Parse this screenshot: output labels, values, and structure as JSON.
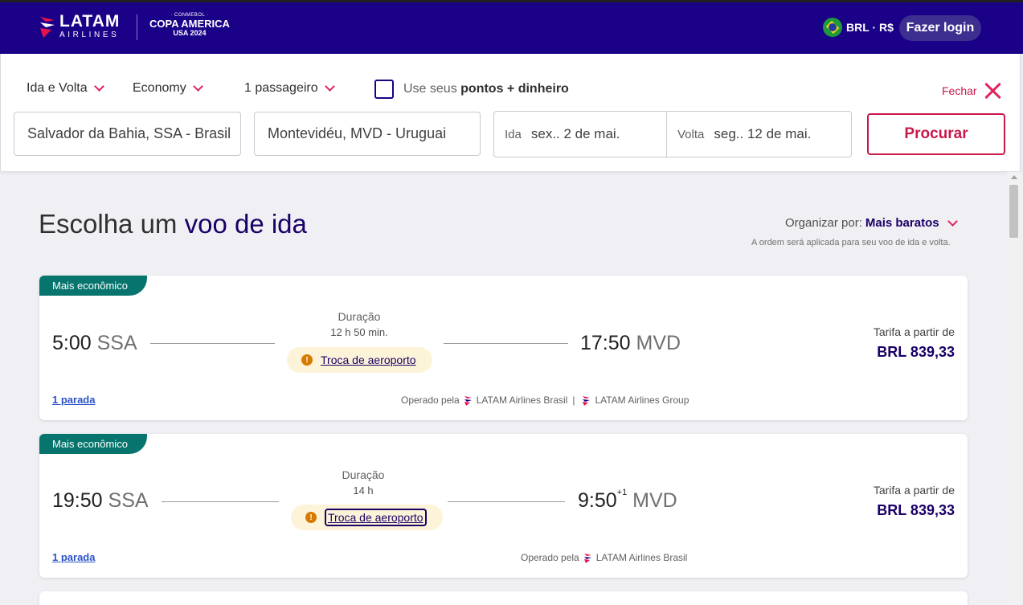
{
  "header": {
    "brand_main": "LATAM",
    "brand_sub": "AIRLINES",
    "copa_top": "· CONMEBOL ·",
    "copa_main": "COPA AMERICA",
    "copa_sub": "USA 2024",
    "currency": "BRL · R$",
    "login_label": "Fazer login"
  },
  "search": {
    "trip_type": "Ida e Volta",
    "cabin": "Economy",
    "passengers": "1 passageiro",
    "points_prefix": "Use seus",
    "points_bold": "pontos + dinheiro",
    "close_label": "Fechar",
    "origin": "Salvador da Bahia, SSA - Brasil",
    "destination": "Montevidéu, MVD - Uruguai",
    "depart_label": "Ida",
    "depart_value": "sex.. 2 de mai.",
    "return_label": "Volta",
    "return_value": "seg.. 12 de mai.",
    "search_button": "Procurar"
  },
  "results": {
    "title_prefix": "Escolha um",
    "title_bold": "voo de ida",
    "sort_label": "Organizar por:",
    "sort_value": "Mais baratos",
    "sort_note": "A ordem será aplicada para seu voo de ida e volta."
  },
  "flights": [
    {
      "badge": "Mais econômico",
      "dep_time": "5:00",
      "dep_airport": "SSA",
      "arr_time": "17:50",
      "arr_plus": "",
      "arr_airport": "MVD",
      "duration_label": "Duração",
      "duration": "12 h 50 min.",
      "airport_change": "Troca de aeroporto",
      "fare_label": "Tarifa a partir de",
      "fare": "BRL 839,33",
      "stops": "1 parada",
      "operated_label": "Operado pela",
      "operator_1": "LATAM Airlines Brasil",
      "operator_sep": "|",
      "operator_2": "LATAM Airlines Group"
    },
    {
      "badge": "Mais econômico",
      "dep_time": "19:50",
      "dep_airport": "SSA",
      "arr_time": "9:50",
      "arr_plus": "+1",
      "arr_airport": "MVD",
      "duration_label": "Duração",
      "duration": "14 h",
      "airport_change": "Troca de aeroporto",
      "fare_label": "Tarifa a partir de",
      "fare": "BRL 839,33",
      "stops": "1 parada",
      "operated_label": "Operado pela",
      "operator_1": "LATAM Airlines Brasil"
    }
  ],
  "colors": {
    "header_bg": "#1b0088",
    "accent": "#e0245e",
    "badge": "#07756e",
    "price": "#1b0066"
  }
}
